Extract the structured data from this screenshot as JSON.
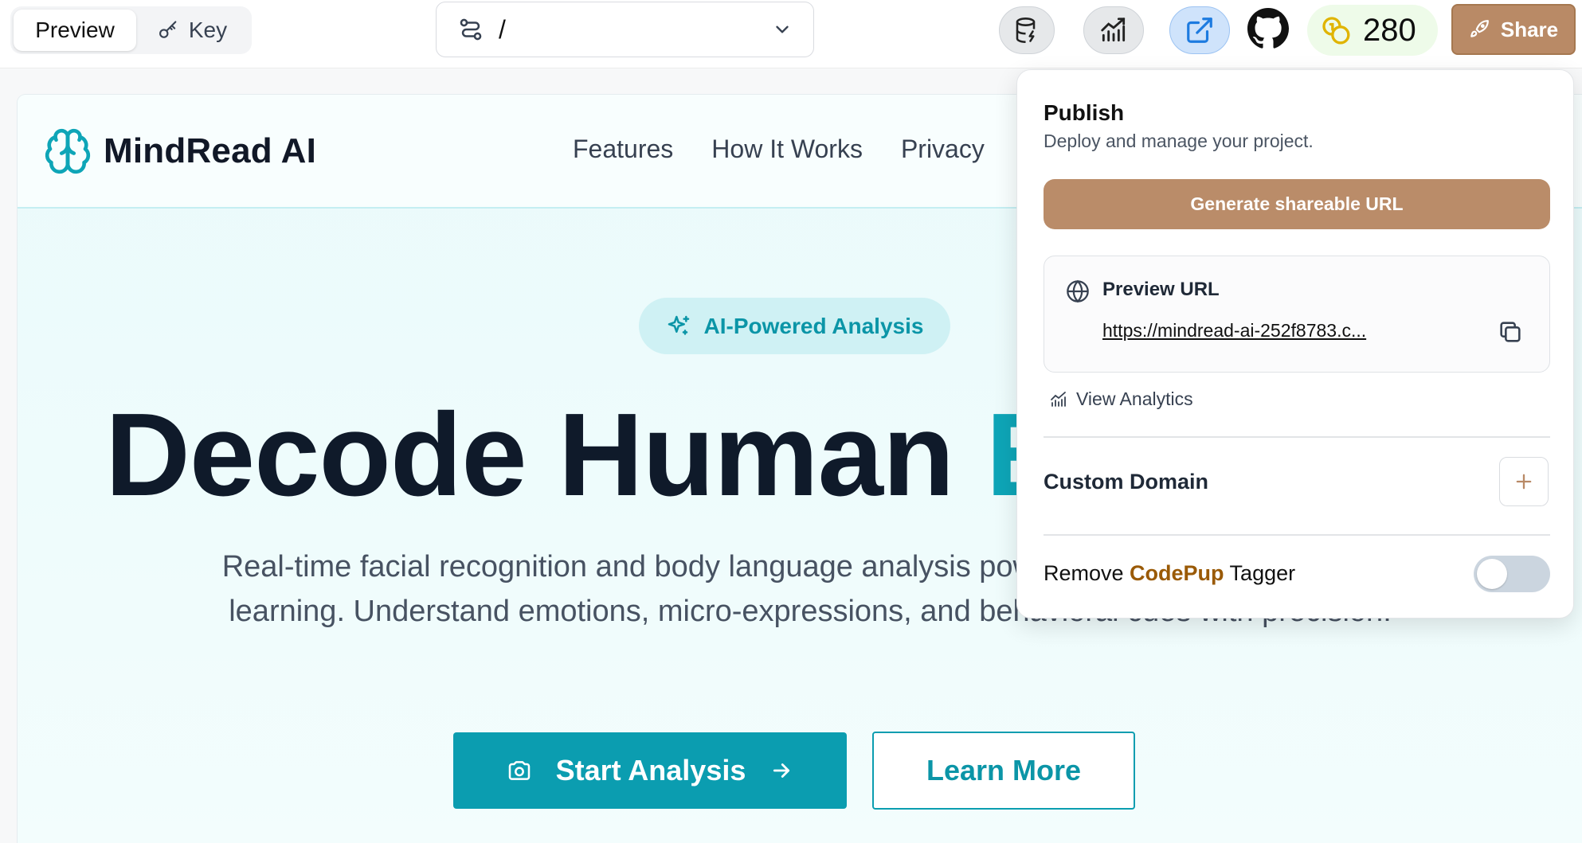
{
  "toolbar": {
    "modes": {
      "preview_label": "Preview",
      "key_label": "Key"
    },
    "route_value": "/",
    "credits": "280",
    "share_label": "Share",
    "icons": [
      "database-icon",
      "analytics-icon",
      "open-external-icon",
      "github-icon",
      "coins-icon",
      "rocket-icon"
    ]
  },
  "site": {
    "brand": "MindRead AI",
    "nav": [
      "Features",
      "How It Works",
      "Privacy"
    ],
    "badge": "AI-Powered Analysis",
    "hero_title_main": "Decode Human ",
    "hero_title_accent": "E",
    "hero_description": "Real-time facial recognition and body language analysis powered by advanced machine learning. Understand emotions, micro-expressions, and behavioral cues with precision.",
    "primary_cta": "Start Analysis",
    "secondary_cta": "Learn More",
    "colors": {
      "accent": "#0ea5b7",
      "heading": "#0f1a2a"
    }
  },
  "share_panel": {
    "title": "Publish",
    "subtitle": "Deploy and manage your project.",
    "generate_label": "Generate shareable URL",
    "preview_url_label": "Preview URL",
    "preview_url": "https://mindread-ai-252f8783.c...",
    "view_analytics": "View Analytics",
    "custom_domain_label": "Custom Domain",
    "tagger_prefix": "Remove ",
    "tagger_brand": "CodePup",
    "tagger_suffix": " Tagger",
    "tagger_enabled": false,
    "colors": {
      "button": "#ba8c69",
      "brandword": "#9a5a06"
    }
  }
}
